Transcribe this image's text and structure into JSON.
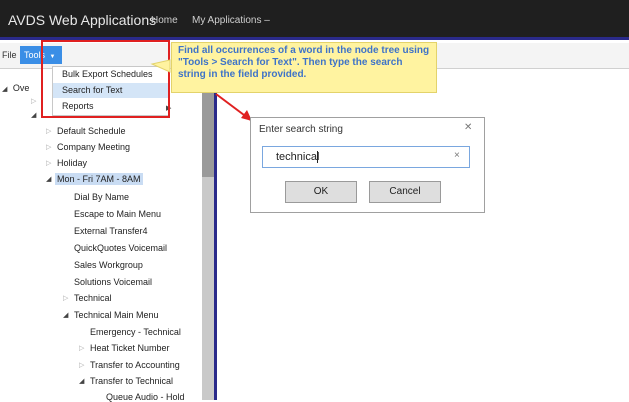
{
  "header": {
    "app_title": "AVDS Web Applications",
    "nav_home": "Home",
    "nav_my_apps": "My Applications –"
  },
  "menubar": {
    "file": "File",
    "tools": "Tools",
    "file_arrow": "▼",
    "tools_arrow": "▼"
  },
  "tools_menu": {
    "items": [
      "Bulk Export Schedules",
      "Search for Text",
      "Reports"
    ],
    "selected": "Search for Text",
    "reports_submenu_arrow": "▶"
  },
  "callout": {
    "text": "Find all occurrences of a word in the node tree using \"Tools > Search for Text\". Then type the search string in the field provided.",
    "color": "#3e73c8"
  },
  "tree": {
    "root_partial": "Ove",
    "items": [
      "Default Schedule",
      "Company Meeting",
      "Holiday",
      "Mon - Fri 7AM - 8AM",
      "Dial By Name",
      "Escape to Main Menu",
      "External Transfer4",
      "QuickQuotes Voicemail",
      "Sales Workgroup",
      "Solutions Voicemail",
      "Technical",
      "Technical Main Menu",
      "Emergency - Technical",
      "Heat Ticket Number",
      "Transfer to Accounting",
      "Transfer to Technical",
      "Queue Audio - Hold"
    ],
    "selected": "Mon - Fri 7AM - 8AM",
    "open_arrow": "◢",
    "closed_arrow": "▷"
  },
  "dialog": {
    "title": "Enter search string",
    "close": "✕",
    "input_value": "technical",
    "clear": "×",
    "ok_label": "OK",
    "cancel_label": "Cancel"
  },
  "colors": {
    "topbar": "#1f1f1f",
    "accent": "#2a2a8a",
    "tools_highlight": "#3a8ee6",
    "annotation_red": "#e02020",
    "callout_bg": "#fff3a0"
  }
}
